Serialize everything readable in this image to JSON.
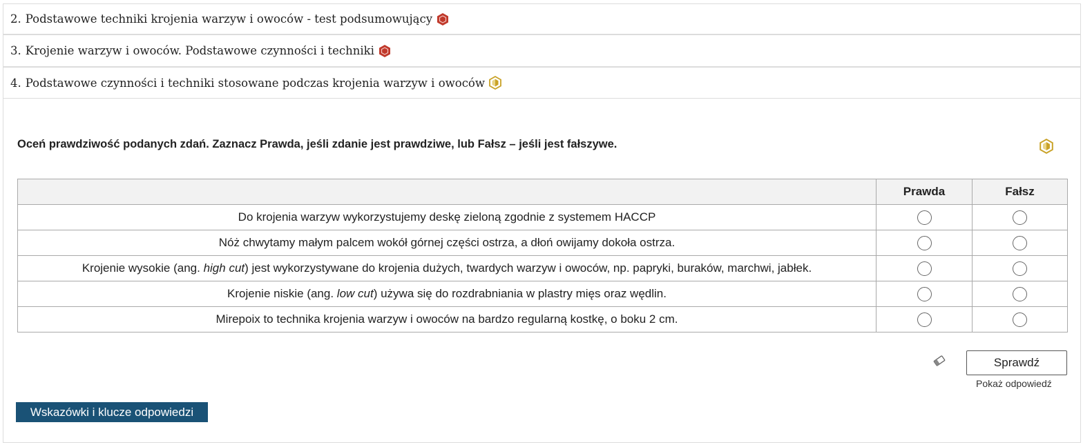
{
  "accordion": [
    {
      "number": "2.",
      "title": "Podstawowe techniki krojenia warzyw i owoców - test podsumowujący",
      "level_icon": "hexagon-red-icon",
      "color": "#c0392b"
    },
    {
      "number": "3.",
      "title": "Krojenie warzyw i owoców. Podstawowe czynności i techniki",
      "level_icon": "hexagon-red-icon",
      "color": "#c0392b"
    },
    {
      "number": "4.",
      "title": "Podstawowe czynności i techniki stosowane podczas krojenia warzyw i owoców",
      "level_icon": "hexagon-half-yellow-icon",
      "color": "#c9a227"
    }
  ],
  "exercise": {
    "instruction": "Oceń prawdziwość podanych zdań. Zaznacz Prawda, jeśli zdanie jest prawdziwe, lub Fałsz – jeśli jest fałszywe.",
    "level_icon": "hexagon-half-yellow-icon",
    "columns": {
      "statement": "",
      "true": "Prawda",
      "false": "Fałsz"
    },
    "rows": [
      {
        "before": "Do krojenia warzyw wykorzystujemy deskę zieloną zgodnie z systemem HACCP",
        "italic": "",
        "after": ""
      },
      {
        "before": "Nóż chwytamy małym palcem wokół górnej części ostrza, a dłoń owijamy dokoła ostrza.",
        "italic": "",
        "after": ""
      },
      {
        "before": "Krojenie wysokie (ang. ",
        "italic": "high cut",
        "after": ") jest wykorzystywane do krojenia dużych, twardych warzyw i owoców, np. papryki, buraków, marchwi, jabłek."
      },
      {
        "before": "Krojenie niskie (ang. ",
        "italic": "low cut",
        "after": ") używa się do rozdrabniania w plastry mięs oraz wędlin."
      },
      {
        "before": "Mirepoix to technika krojenia warzyw i owoców na bardzo regularną kostkę, o boku 2 cm.",
        "italic": "",
        "after": ""
      }
    ],
    "eraser_icon": "eraser-icon",
    "check_label": "Sprawdź",
    "show_answer_label": "Pokaż odpowiedź"
  },
  "hints_button_label": "Wskazówki i klucze odpowiedzi",
  "colors": {
    "accent": "#1a5276",
    "level_red": "#c0392b",
    "level_yellow": "#c9a227"
  }
}
